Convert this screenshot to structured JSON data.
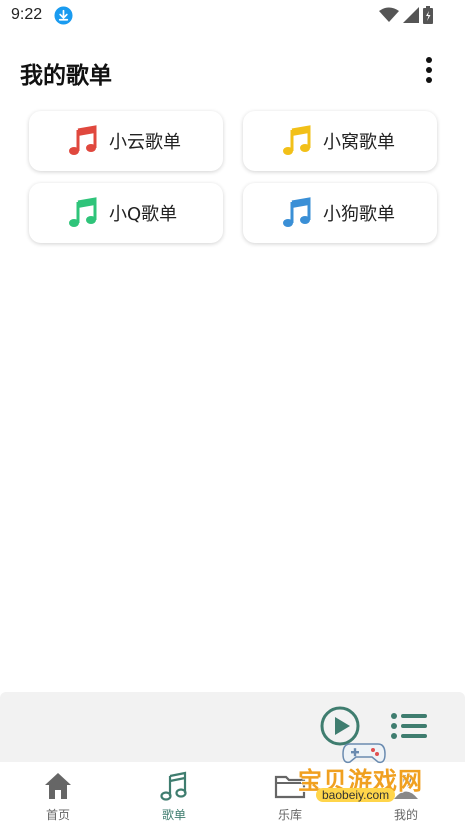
{
  "status": {
    "time": "9:22"
  },
  "header": {
    "title": "我的歌单"
  },
  "playlists": [
    {
      "label": "小云歌单",
      "color": "#e0483e"
    },
    {
      "label": "小窝歌单",
      "color": "#f2c018"
    },
    {
      "label": "小Q歌单",
      "color": "#2fc47a"
    },
    {
      "label": "小狗歌单",
      "color": "#3a8fd6"
    }
  ],
  "player": {
    "accent": "#3f7d6f"
  },
  "nav": [
    {
      "label": "首页"
    },
    {
      "label": "歌单"
    },
    {
      "label": "乐库"
    },
    {
      "label": "我的"
    }
  ],
  "watermark": {
    "text": "宝贝游戏网",
    "url": "baobeiy.com"
  }
}
